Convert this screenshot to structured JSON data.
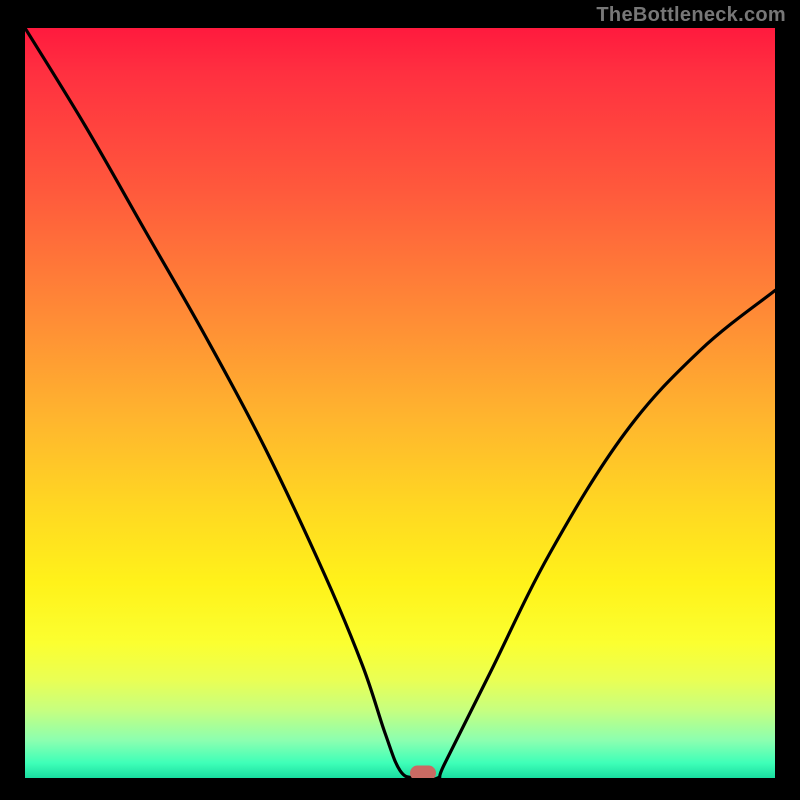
{
  "watermark": "TheBottleneck.com",
  "chart_data": {
    "type": "line",
    "title": "",
    "xlabel": "",
    "ylabel": "",
    "xlim": [
      0,
      100
    ],
    "ylim": [
      0,
      100
    ],
    "series": [
      {
        "name": "bottleneck-curve",
        "x": [
          0,
          8,
          16,
          24,
          32,
          40,
          45,
          48,
          50,
          52,
          55,
          56,
          62,
          70,
          80,
          90,
          100
        ],
        "values": [
          100,
          87,
          73,
          59,
          44,
          27,
          15,
          6,
          1,
          0,
          0,
          2,
          14,
          30,
          46,
          57,
          65
        ]
      }
    ],
    "marker": {
      "x": 53,
      "y": 0
    },
    "gradient_stops": [
      {
        "pos": 0,
        "color": "#ff1a3e"
      },
      {
        "pos": 50,
        "color": "#ffb52e"
      },
      {
        "pos": 80,
        "color": "#fff21a"
      },
      {
        "pos": 100,
        "color": "#19dda0"
      }
    ]
  }
}
